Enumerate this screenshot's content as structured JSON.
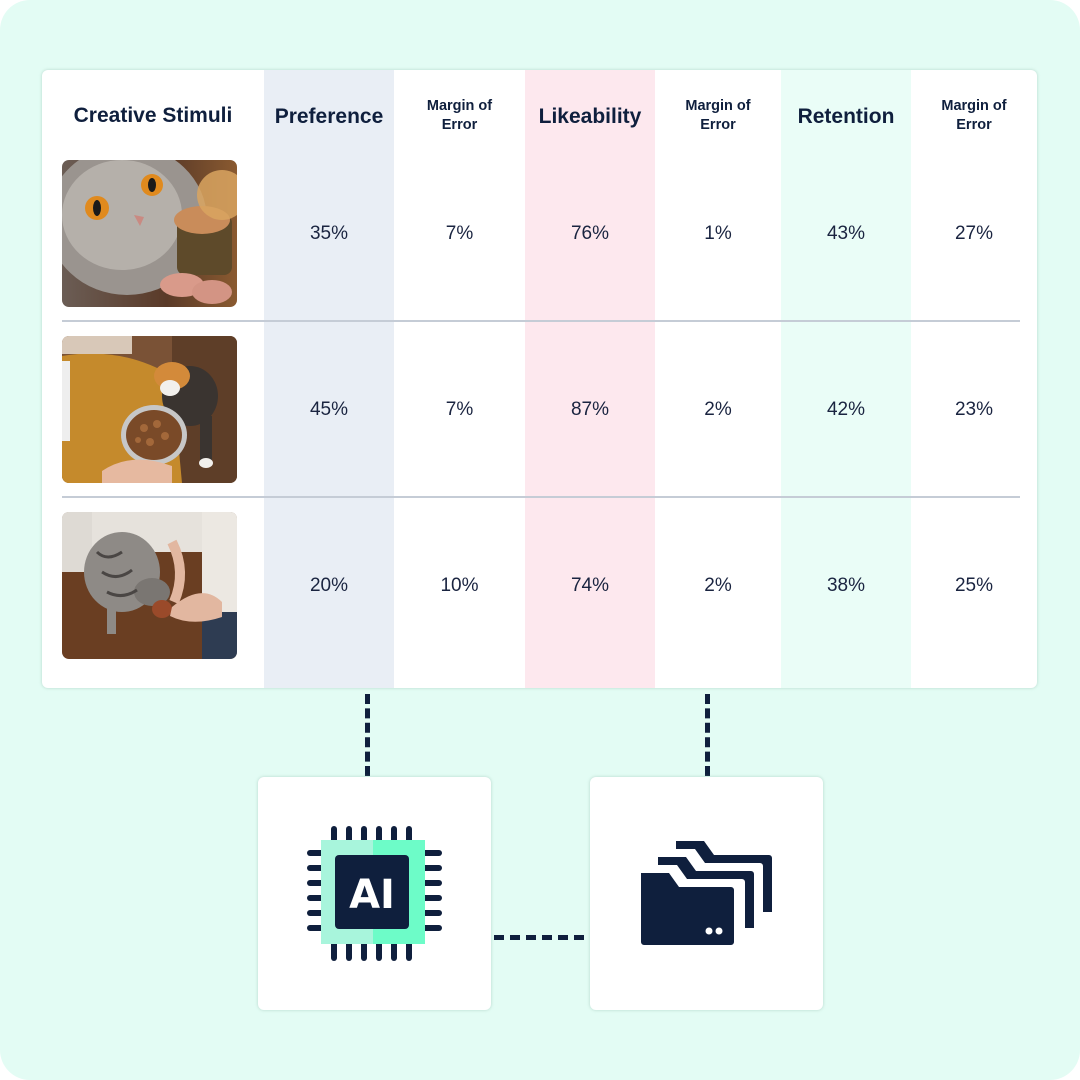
{
  "table": {
    "headers": {
      "stimuli": "Creative Stimuli",
      "preference": "Preference",
      "preference_moe": "Margin of Error",
      "likeability": "Likeability",
      "likeability_moe": "Margin of Error",
      "retention": "Retention",
      "retention_moe": "Margin of Error"
    },
    "rows": [
      {
        "image": "cat-with-canned-food-closeup",
        "preference": "35%",
        "preference_moe": "7%",
        "likeability": "76%",
        "likeability_moe": "1%",
        "retention": "43%",
        "retention_moe": "27%"
      },
      {
        "image": "calico-cat-with-food-bowl",
        "preference": "45%",
        "preference_moe": "7%",
        "likeability": "87%",
        "likeability_moe": "2%",
        "retention": "42%",
        "retention_moe": "23%"
      },
      {
        "image": "tabby-cat-eating-from-can",
        "preference": "20%",
        "preference_moe": "10%",
        "likeability": "74%",
        "likeability_moe": "2%",
        "retention": "38%",
        "retention_moe": "25%"
      }
    ]
  },
  "icons": {
    "ai_chip": {
      "label": "AI",
      "name": "ai-chip-icon"
    },
    "folders": {
      "name": "folders-icon"
    }
  },
  "colors": {
    "background": "#e3fcf4",
    "navy": "#0f1f3d",
    "preference_band": "#e9eef5",
    "likeability_band": "#fde8ee",
    "retention_band": "#eafdf7",
    "chip_light": "#a8f5dc",
    "chip_bright": "#6dfcc8"
  }
}
